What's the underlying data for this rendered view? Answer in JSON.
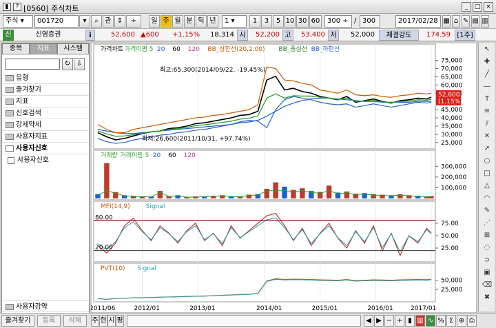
{
  "window": {
    "help_icon": "?",
    "title": "[0560] 주식차트",
    "buttons": [
      "_",
      "□",
      "×"
    ]
  },
  "toolbar": {
    "market": "주식",
    "code": "001720",
    "btn_kan": "관",
    "period_buttons": [
      "일",
      "주",
      "월",
      "분",
      "틱",
      "년"
    ],
    "period_selected": "주",
    "interval": "1",
    "interval_buttons": [
      "1",
      "3",
      "5",
      "10",
      "30",
      "60"
    ],
    "count_value": "300",
    "count_total": "300",
    "date": "2017/02/28",
    "icons": [
      "calendar-icon",
      "home-icon",
      "tools-icon",
      "grid-icon",
      "layout-icon",
      "table-icon"
    ]
  },
  "info": {
    "badge": "신",
    "company": "신영증권",
    "i_label": "i",
    "price": "52,600",
    "change": "▲600",
    "change_pct": "+1.15%",
    "volume": "18,314",
    "open_label": "시",
    "open": "52,200",
    "high_label": "고",
    "high": "53,400",
    "low_label": "저",
    "low": "52,000",
    "strength_label": "체결강도",
    "strength": "174.59",
    "unit_label": "[1주]"
  },
  "sidebar": {
    "tabs": [
      "종목",
      "지표",
      "시스템"
    ],
    "active_tab": "지표",
    "search_value": "",
    "folders": [
      "유형",
      "즐겨찾기",
      "지표",
      "신호검색",
      "강세약세",
      "사용자지표",
      "사용자신호"
    ],
    "leaf": "사용자신호",
    "bottom_folder": "사용자강약"
  },
  "bottom": {
    "buttons": [
      "즐겨찾기",
      "등록",
      "삭제"
    ],
    "tabs": [
      "주",
      "현",
      "시",
      "평"
    ],
    "nav_icons": [
      "prev-icon",
      "next-icon",
      "zoom-out-icon",
      "zoom-in-icon",
      "bar-icon",
      "candle-icon",
      "line-icon",
      "percent-icon",
      "sigma-icon",
      "plus-icon",
      "print-icon"
    ]
  },
  "chart_data": [
    {
      "type": "line",
      "title": "가격차트",
      "legend": [
        "가격차트",
        "가격이평 5",
        "20",
        "60",
        "120",
        "BB_상한선(20,2.00)",
        "BB_중심선",
        "BB_하한선"
      ],
      "y_ticks": [
        25000,
        30000,
        35000,
        40000,
        45000,
        50000,
        55000,
        60000,
        65000,
        70000,
        75000
      ],
      "y_tick_labels": [
        "25,000",
        "30,000",
        "35,000",
        "40,000",
        "45,000",
        "50,000",
        "55,000",
        "60,000",
        "65,000",
        "70,000",
        "75,000"
      ],
      "ylim": [
        22000,
        79000
      ],
      "annotations": [
        "최고:65,300(2014/09/22, -19.45%)",
        "최저:26,600(2011/10/31, +97.74%)"
      ],
      "last_price": "52,600",
      "last_change": "(1.15%)",
      "x": [
        0,
        8,
        16,
        24,
        32,
        40,
        48,
        56,
        64,
        72,
        80,
        88,
        96,
        104,
        112,
        120,
        128,
        136,
        144,
        152,
        160,
        168,
        176,
        184,
        192,
        200,
        208,
        216,
        224,
        232,
        240,
        248,
        256,
        264,
        272,
        280,
        288,
        296,
        300
      ],
      "series": [
        {
          "name": "가격차트",
          "values": [
            31000,
            28500,
            26600,
            27500,
            29000,
            30500,
            31500,
            32000,
            33500,
            34000,
            35000,
            36500,
            37000,
            38000,
            39000,
            40000,
            41500,
            42000,
            44000,
            63000,
            65300,
            57000,
            58000,
            56000,
            55000,
            53000,
            52000,
            51000,
            53000,
            49500,
            50500,
            51500,
            50000,
            49000,
            50500,
            51000,
            52000,
            51500,
            52600
          ]
        },
        {
          "name": "120",
          "values": [
            33000,
            32000,
            31000,
            30500,
            30500,
            31000,
            31500,
            32000,
            32500,
            33000,
            33500,
            34000,
            34500,
            35000,
            35500,
            36000,
            37000,
            37500,
            38500,
            41000,
            44000,
            47000,
            49000,
            50500,
            51500,
            52000,
            52000,
            51500,
            51000,
            50500,
            50000,
            50000,
            49500,
            49500,
            49500,
            49500,
            50000,
            50000,
            50000
          ]
        },
        {
          "name": "BB_상한선(20,2.00)",
          "values": [
            36000,
            33000,
            31000,
            31000,
            33000,
            34000,
            35000,
            36000,
            37000,
            38000,
            39000,
            40000,
            40500,
            41500,
            42000,
            43000,
            44000,
            45000,
            48000,
            71000,
            70000,
            63000,
            62500,
            61000,
            60000,
            57000,
            56000,
            55000,
            57000,
            54000,
            53500,
            54000,
            53000,
            52500,
            53500,
            54000,
            55000,
            54500,
            55000
          ]
        },
        {
          "name": "BB_하한선",
          "values": [
            27500,
            25500,
            24500,
            25000,
            26500,
            27500,
            28500,
            29500,
            30000,
            31000,
            31500,
            32500,
            33000,
            34000,
            35000,
            36000,
            37500,
            38500,
            38000,
            34000,
            45000,
            51000,
            53000,
            52000,
            51000,
            49500,
            48500,
            48000,
            48500,
            46500,
            47500,
            48500,
            47500,
            46500,
            47500,
            48500,
            49500,
            49000,
            49500
          ]
        }
      ]
    },
    {
      "type": "bar",
      "title": "거래량",
      "legend": [
        "거래량",
        "거래이평 5",
        "20",
        "60",
        "120"
      ],
      "y_ticks": [
        100000,
        200000,
        300000
      ],
      "y_tick_labels": [
        "100,000",
        "200,000",
        "300,000"
      ],
      "ylim": [
        0,
        360000
      ],
      "x": [
        0,
        8,
        16,
        24,
        32,
        40,
        48,
        56,
        64,
        72,
        80,
        88,
        96,
        104,
        112,
        120,
        128,
        136,
        144,
        152,
        160,
        168,
        176,
        184,
        192,
        200,
        208,
        216,
        224,
        232,
        240,
        248,
        256,
        264,
        272,
        280,
        288,
        296,
        300
      ],
      "values": [
        40000,
        330000,
        60000,
        30000,
        25000,
        20000,
        18000,
        70000,
        22000,
        30000,
        15000,
        18000,
        20000,
        25000,
        30000,
        22000,
        20000,
        35000,
        40000,
        90000,
        150000,
        110000,
        80000,
        95000,
        70000,
        60000,
        120000,
        55000,
        65000,
        45000,
        50000,
        40000,
        35000,
        30000,
        40000,
        30000,
        25000,
        20000,
        22000
      ]
    },
    {
      "type": "line",
      "title": "MFI(14,9)",
      "legend": [
        "MFI(14,9)",
        "Signal"
      ],
      "y_ticks": [
        25,
        50,
        75
      ],
      "y_tick_labels": [
        "25.00",
        "50.00",
        "75.00"
      ],
      "levels": [
        "80.00",
        "20.00"
      ],
      "ylim": [
        0,
        100
      ],
      "x": [
        0,
        8,
        16,
        24,
        32,
        40,
        48,
        56,
        64,
        72,
        80,
        88,
        96,
        104,
        112,
        120,
        128,
        136,
        144,
        152,
        160,
        168,
        176,
        184,
        192,
        200,
        208,
        216,
        224,
        232,
        240,
        248,
        256,
        264,
        272,
        280,
        288,
        296,
        300
      ],
      "values": [
        30,
        15,
        35,
        70,
        85,
        60,
        40,
        70,
        55,
        35,
        60,
        75,
        40,
        55,
        30,
        70,
        45,
        60,
        75,
        90,
        95,
        70,
        40,
        65,
        30,
        55,
        75,
        45,
        25,
        60,
        35,
        70,
        20,
        55,
        10,
        50,
        35,
        65,
        55
      ]
    },
    {
      "type": "line",
      "title": "PVT(10)",
      "legend": [
        "PVT(10)",
        "Signal"
      ],
      "y_ticks": [
        25000,
        50000
      ],
      "y_tick_labels": [
        "25,000",
        "50,000"
      ],
      "ylim": [
        -5000,
        70000
      ],
      "x_labels": [
        "2011/06",
        "2012/01",
        "2013/01",
        "2014/01",
        "2015/01",
        "2016/01",
        "2017/01"
      ],
      "x": [
        0,
        8,
        16,
        24,
        32,
        40,
        48,
        56,
        64,
        72,
        80,
        88,
        96,
        104,
        112,
        120,
        128,
        136,
        144,
        152,
        160,
        168,
        176,
        184,
        192,
        200,
        208,
        216,
        224,
        232,
        240,
        248,
        256,
        264,
        272,
        280,
        288,
        296,
        300
      ],
      "values": [
        0,
        -2000,
        500,
        1000,
        2000,
        2500,
        3000,
        4000,
        4500,
        5000,
        6000,
        6500,
        7000,
        8000,
        9000,
        10000,
        11000,
        12000,
        14000,
        48000,
        54000,
        52000,
        53000,
        52500,
        52000,
        51000,
        50500,
        50000,
        52000,
        49000,
        50000,
        51000,
        50500,
        50000,
        51000,
        51500,
        52000,
        51500,
        52500
      ]
    }
  ]
}
